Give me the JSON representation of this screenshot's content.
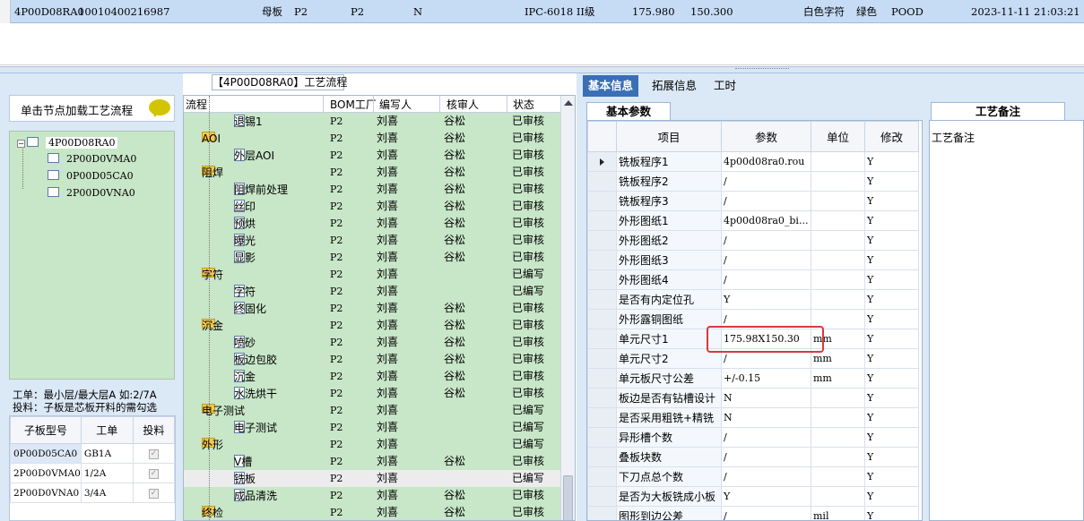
{
  "top_row": {
    "cells": [
      "4P00D08RA0",
      "10010400216987",
      "母板",
      "P2",
      "P2",
      "N",
      "IPC-6018 II级",
      "175.980",
      "150.300",
      "白色字符",
      "绿色",
      "POOD",
      "2023-11-11 21:03:21"
    ]
  },
  "left_panel": {
    "header": "单击节点加载工艺流程",
    "tree": {
      "root": "4P00D08RA0",
      "children": [
        "2P00D0VMA0",
        "0P00D05CA0",
        "2P00D0VNA0"
      ]
    },
    "note_line1": "工单：最小层/最大层A 如:2/7A",
    "note_line2": "投料：子板是芯板开料的需勾选",
    "sub_table": {
      "headers": [
        "子板型号",
        "工单",
        "投料"
      ],
      "rows": [
        {
          "model": "0P00D05CA0",
          "order": "GB1A",
          "feed": true
        },
        {
          "model": "2P00D0VMA0",
          "order": "1/2A",
          "feed": true
        },
        {
          "model": "2P00D0VNA0",
          "order": "3/4A",
          "feed": true
        }
      ]
    }
  },
  "flow": {
    "title": "【4P00D08RA0】工艺流程",
    "headers": [
      "流程",
      "BOM工厂",
      "编写人",
      "核审人",
      "状态"
    ],
    "rows": [
      {
        "level": 1,
        "name": "退锡1",
        "bom": "P2",
        "writer": "刘喜",
        "reviewer": "谷松",
        "status": "已审核"
      },
      {
        "level": 0,
        "name": "AOI",
        "bom": "P2",
        "writer": "刘喜",
        "reviewer": "谷松",
        "status": "已审核"
      },
      {
        "level": 1,
        "name": "外层AOI",
        "bom": "P2",
        "writer": "刘喜",
        "reviewer": "谷松",
        "status": "已审核"
      },
      {
        "level": 0,
        "name": "阻焊",
        "bom": "P2",
        "writer": "刘喜",
        "reviewer": "谷松",
        "status": "已审核"
      },
      {
        "level": 1,
        "name": "阻焊前处理",
        "bom": "P2",
        "writer": "刘喜",
        "reviewer": "谷松",
        "status": "已审核"
      },
      {
        "level": 1,
        "name": "丝印",
        "bom": "P2",
        "writer": "刘喜",
        "reviewer": "谷松",
        "status": "已审核"
      },
      {
        "level": 1,
        "name": "预烘",
        "bom": "P2",
        "writer": "刘喜",
        "reviewer": "谷松",
        "status": "已审核"
      },
      {
        "level": 1,
        "name": "曝光",
        "bom": "P2",
        "writer": "刘喜",
        "reviewer": "谷松",
        "status": "已审核"
      },
      {
        "level": 1,
        "name": "显影",
        "bom": "P2",
        "writer": "刘喜",
        "reviewer": "谷松",
        "status": "已审核"
      },
      {
        "level": 0,
        "name": "字符",
        "bom": "P2",
        "writer": "刘喜",
        "reviewer": "",
        "status": "已编写"
      },
      {
        "level": 1,
        "name": "字符",
        "bom": "P2",
        "writer": "刘喜",
        "reviewer": "",
        "status": "已编写"
      },
      {
        "level": 1,
        "name": "终固化",
        "bom": "P2",
        "writer": "刘喜",
        "reviewer": "谷松",
        "status": "已审核"
      },
      {
        "level": 0,
        "name": "沉金",
        "bom": "P2",
        "writer": "刘喜",
        "reviewer": "谷松",
        "status": "已审核"
      },
      {
        "level": 1,
        "name": "喷砂",
        "bom": "P2",
        "writer": "刘喜",
        "reviewer": "谷松",
        "status": "已审核"
      },
      {
        "level": 1,
        "name": "板边包胶",
        "bom": "P2",
        "writer": "刘喜",
        "reviewer": "谷松",
        "status": "已审核"
      },
      {
        "level": 1,
        "name": "沉金",
        "bom": "P2",
        "writer": "刘喜",
        "reviewer": "谷松",
        "status": "已审核"
      },
      {
        "level": 1,
        "name": "水洗烘干",
        "bom": "P2",
        "writer": "刘喜",
        "reviewer": "谷松",
        "status": "已审核"
      },
      {
        "level": 0,
        "name": "电子测试",
        "bom": "P2",
        "writer": "刘喜",
        "reviewer": "",
        "status": "已编写"
      },
      {
        "level": 1,
        "name": "电子测试",
        "bom": "P2",
        "writer": "刘喜",
        "reviewer": "",
        "status": "已编写"
      },
      {
        "level": 0,
        "name": "外形",
        "bom": "P2",
        "writer": "刘喜",
        "reviewer": "",
        "status": "已编写"
      },
      {
        "level": 1,
        "name": "V槽",
        "bom": "P2",
        "writer": "刘喜",
        "reviewer": "谷松",
        "status": "已审核"
      },
      {
        "level": 1,
        "name": "铣板",
        "bom": "P2",
        "writer": "刘喜",
        "reviewer": "",
        "status": "已编写",
        "highlight": true
      },
      {
        "level": 1,
        "name": "成品清洗",
        "bom": "P2",
        "writer": "刘喜",
        "reviewer": "谷松",
        "status": "已审核"
      },
      {
        "level": 0,
        "name": "终检",
        "bom": "P2",
        "writer": "刘喜",
        "reviewer": "谷松",
        "status": "已审核"
      }
    ]
  },
  "right_panel": {
    "tabs": [
      "基本信息",
      "拓展信息",
      "工时"
    ],
    "subtab_params": "基本参数",
    "subtab_notes": "工艺备注",
    "notes_label": "工艺备注",
    "param_headers": [
      "项目",
      "参数",
      "单位",
      "修改"
    ],
    "params": [
      {
        "item": "铣板程序1",
        "value": "4p00d08ra0.rou",
        "unit": "",
        "mod": "Y"
      },
      {
        "item": "铣板程序2",
        "value": "/",
        "unit": "",
        "mod": "Y"
      },
      {
        "item": "铣板程序3",
        "value": "/",
        "unit": "",
        "mod": "Y"
      },
      {
        "item": "外形图纸1",
        "value": "4p00d08ra0_bi...",
        "unit": "",
        "mod": "Y"
      },
      {
        "item": "外形图纸2",
        "value": "/",
        "unit": "",
        "mod": "Y"
      },
      {
        "item": "外形图纸3",
        "value": "/",
        "unit": "",
        "mod": "Y"
      },
      {
        "item": "外形图纸4",
        "value": "/",
        "unit": "",
        "mod": "Y"
      },
      {
        "item": "是否有内定位孔",
        "value": "Y",
        "unit": "",
        "mod": "Y"
      },
      {
        "item": "外形露铜图纸",
        "value": "/",
        "unit": "",
        "mod": "Y"
      },
      {
        "item": "单元尺寸1",
        "value": "175.98X150.30",
        "unit": "mm",
        "mod": "Y"
      },
      {
        "item": "单元尺寸2",
        "value": "/",
        "unit": "mm",
        "mod": "Y"
      },
      {
        "item": "单元板尺寸公差",
        "value": "+/-0.15",
        "unit": "mm",
        "mod": "Y"
      },
      {
        "item": "板边是否有钻槽设计",
        "value": "N",
        "unit": "",
        "mod": "Y"
      },
      {
        "item": "是否采用粗铣+精铣",
        "value": "N",
        "unit": "",
        "mod": "Y"
      },
      {
        "item": "异形槽个数",
        "value": "/",
        "unit": "",
        "mod": "Y"
      },
      {
        "item": "叠板块数",
        "value": "/",
        "unit": "",
        "mod": "Y"
      },
      {
        "item": "下刀点总个数",
        "value": "/",
        "unit": "",
        "mod": "Y"
      },
      {
        "item": "是否为大板铣成小板",
        "value": "Y",
        "unit": "",
        "mod": "Y"
      },
      {
        "item": "图形到边公差",
        "value": "/",
        "unit": "mil",
        "mod": "Y"
      }
    ]
  },
  "colors": {
    "selection_blue": "#c6dcf5",
    "tree_green": "#c8e6c8",
    "active_tab": "#3a6fb5",
    "highlight_red": "#d83a3a"
  }
}
